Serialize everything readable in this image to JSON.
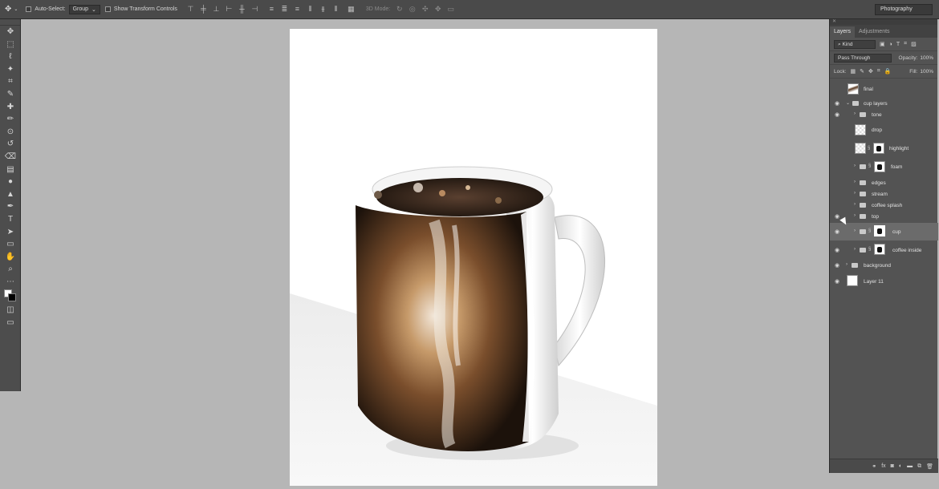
{
  "options_bar": {
    "move_icon": "move-tool-icon",
    "auto_select_label": "Auto-Select:",
    "auto_select_value": "Group",
    "show_transform_label": "Show Transform Controls",
    "mode_3d_label": "3D Mode:",
    "workspace": "Photography"
  },
  "tools": [
    "move-tool-icon",
    "marquee-tool-icon",
    "lasso-tool-icon",
    "magic-wand-icon",
    "crop-tool-icon",
    "eyedropper-icon",
    "healing-brush-icon",
    "brush-tool-icon",
    "clone-stamp-icon",
    "history-brush-icon",
    "eraser-icon",
    "gradient-tool-icon",
    "blur-tool-icon",
    "dodge-tool-icon",
    "pen-tool-icon",
    "type-tool-icon",
    "path-selection-icon",
    "shape-tool-icon",
    "hand-tool-icon",
    "zoom-tool-icon",
    "more-tools-icon"
  ],
  "layers_panel": {
    "tabs": [
      {
        "label": "Layers",
        "active": true
      },
      {
        "label": "Adjustments",
        "active": false
      }
    ],
    "filter_label": "Kind",
    "blend_mode": "Pass Through",
    "opacity_label": "Opacity:",
    "opacity_value": "100%",
    "lock_label": "Lock:",
    "fill_label": "Fill:",
    "fill_value": "100%",
    "layers": [
      {
        "name": "final",
        "visible": false,
        "kind": "pixel",
        "indent": 0
      },
      {
        "name": "cup layers",
        "visible": true,
        "kind": "group",
        "indent": 0,
        "expanded": true
      },
      {
        "name": "tone",
        "visible": true,
        "kind": "group",
        "indent": 1
      },
      {
        "name": "drop",
        "visible": false,
        "kind": "pixel",
        "indent": 1
      },
      {
        "name": "highlight",
        "visible": false,
        "kind": "masked",
        "indent": 1
      },
      {
        "name": "foam",
        "visible": false,
        "kind": "group-masked",
        "indent": 1
      },
      {
        "name": "edges",
        "visible": false,
        "kind": "group",
        "indent": 1
      },
      {
        "name": "stream",
        "visible": false,
        "kind": "group",
        "indent": 1
      },
      {
        "name": "coffee splash",
        "visible": false,
        "kind": "group",
        "indent": 1
      },
      {
        "name": "top",
        "visible": true,
        "kind": "group",
        "indent": 1
      },
      {
        "name": "cup",
        "visible": true,
        "kind": "group-masked",
        "indent": 1,
        "selected": true
      },
      {
        "name": "coffee inside",
        "visible": true,
        "kind": "group-masked",
        "indent": 1
      },
      {
        "name": "background",
        "visible": true,
        "kind": "group",
        "indent": 0
      },
      {
        "name": "Layer 11",
        "visible": true,
        "kind": "fill",
        "indent": 0
      }
    ],
    "bottom_icons": [
      "link-icon",
      "fx-icon",
      "mask-icon",
      "adjustment-icon",
      "new-group-icon",
      "new-layer-icon",
      "trash-icon"
    ]
  },
  "colors": {
    "app_bg": "#b6b6b6",
    "panel_bg": "#535353",
    "bar_bg": "#4a4a4a",
    "coffee_dark": "#2a1a10",
    "coffee_light": "#b07a48"
  }
}
